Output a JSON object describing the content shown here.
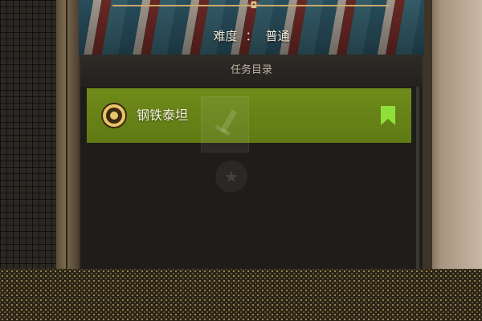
{
  "header": {
    "difficulty_label": "难度",
    "separator": "：",
    "difficulty_value": "普通",
    "ornament": "◦◘◦"
  },
  "panel": {
    "title": "任务目录",
    "quests": [
      {
        "name": "钢铁泰坦",
        "icon": "target-icon",
        "bookmarked": true
      }
    ]
  },
  "colors": {
    "quest_selected": "#6f8b1a",
    "bookmark": "#8fe03a",
    "target_ring": "#e9c46a",
    "title_text": "#f2ead8"
  }
}
